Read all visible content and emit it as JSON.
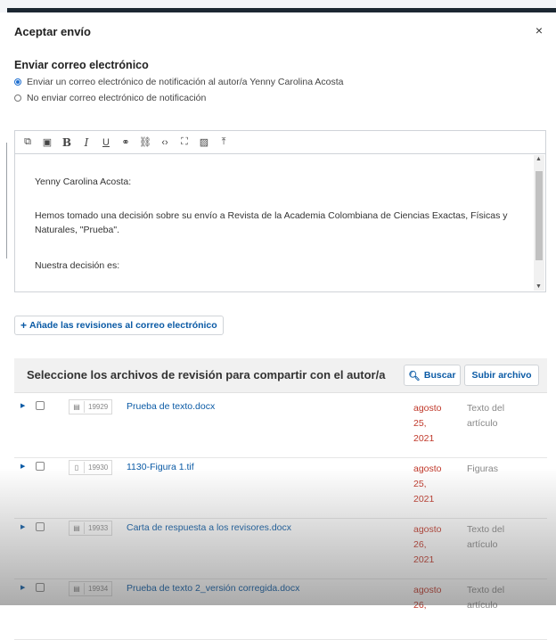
{
  "modal": {
    "title": "Aceptar envío",
    "close_glyph": "×"
  },
  "email": {
    "section_title": "Enviar correo electrónico",
    "options": [
      {
        "label": "Enviar un correo electrónico de notificación al autor/a Yenny Carolina Acosta",
        "selected": true
      },
      {
        "label": "No enviar correo electrónico de notificación",
        "selected": false
      }
    ],
    "toolbar_icons": [
      "copy-icon",
      "paste-icon",
      "bold-icon",
      "italic-icon",
      "underline-icon",
      "link-icon",
      "unlink-icon",
      "code-icon",
      "fullscreen-icon",
      "image-icon",
      "upload-icon"
    ],
    "body": {
      "greeting": "Yenny Carolina Acosta:",
      "paragraph": "Hemos tomado una decisión sobre su envío a Revista de la Academia Colombiana de Ciencias Exactas, Físicas y Naturales, \"Prueba\".",
      "decision": "Nuestra decisión es:"
    }
  },
  "add_reviews_button": "Añade las revisiones al correo electrónico",
  "files": {
    "header": "Seleccione los archivos de revisión para compartir con el autor/a",
    "search_label": "Buscar",
    "upload_label": "Subir archivo",
    "rows": [
      {
        "id": "19929",
        "name": "Prueba de texto.docx",
        "date_l1": "agosto",
        "date_l2": "25,",
        "date_l3": "2021",
        "type_l1": "Texto del",
        "type_l2": "artículo",
        "icon": "document-icon"
      },
      {
        "id": "19930",
        "name": "1130-Figura 1.tif",
        "date_l1": "agosto",
        "date_l2": "25,",
        "date_l3": "2021",
        "type_l1": "Figuras",
        "type_l2": "",
        "icon": "file-icon"
      },
      {
        "id": "19933",
        "name": "Carta de respuesta a los revisores.docx",
        "date_l1": "agosto",
        "date_l2": "26,",
        "date_l3": "2021",
        "type_l1": "Texto del",
        "type_l2": "artículo",
        "icon": "document-icon"
      },
      {
        "id": "19934",
        "name": "Prueba de texto 2_versión corregida.docx",
        "date_l1": "agosto",
        "date_l2": "26,",
        "date_l3": "",
        "type_l1": "Texto del",
        "type_l2": "artículo",
        "icon": "document-icon"
      }
    ]
  },
  "colors": {
    "accent": "#0a5aa5",
    "date": "#c0392b",
    "radio": "#1f6fd0"
  }
}
